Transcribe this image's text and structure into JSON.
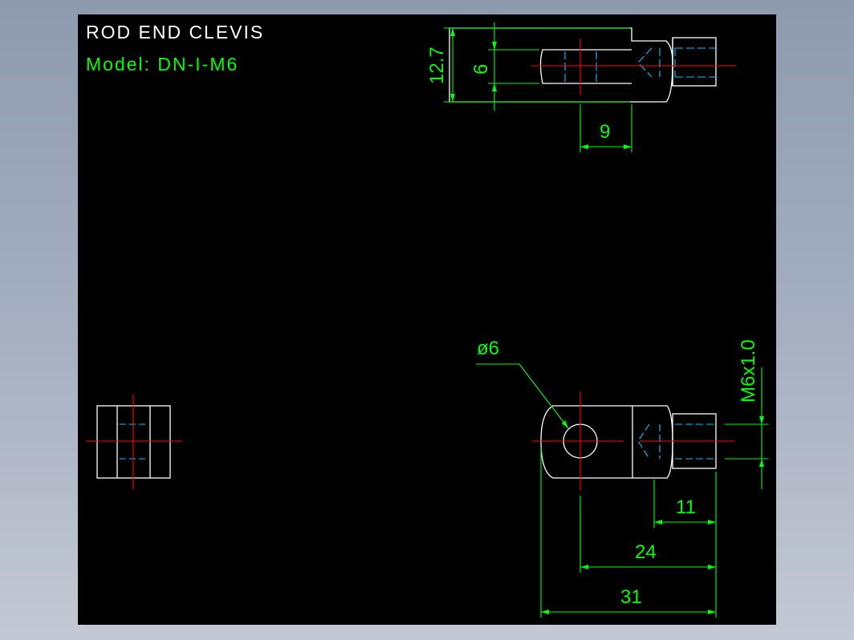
{
  "title": {
    "line1": "ROD END CLEVIS",
    "line2": "Model: DN-I-M6"
  },
  "dimensions": {
    "top_height": "12.7",
    "top_slot": "6",
    "top_depth": "9",
    "hole_diameter": "ø6",
    "thread": "M6x1.0",
    "thread_length": "11",
    "pin_to_end": "24",
    "overall_length": "31"
  },
  "colors": {
    "background": "#000000",
    "outline": "#ffffff",
    "dimension": "#00ff00",
    "centerline": "#ff0000",
    "hidden": "#00c8ff"
  }
}
